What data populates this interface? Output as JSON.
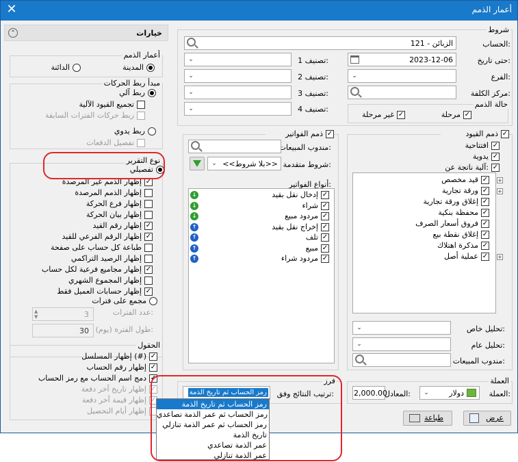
{
  "window": {
    "title": "أعمار الذمم",
    "close": "✕"
  },
  "options": {
    "header": "خيارات",
    "debt_ages": {
      "title": "أعمار الذمم",
      "debit": "المدينة",
      "credit": "الدائنة"
    },
    "link": {
      "title": "مبدأ ربط الحركات",
      "auto": "ربط آلي",
      "group_auto": "تجميع القيود الآلية",
      "link_prev": "ربط حركات الفترات السابقة",
      "manual": "ربط يدوي",
      "payment_detail": "تفصيل الدفعات"
    },
    "report_type": {
      "title": "نوع التقرير",
      "detailed": "تفصيلي",
      "items": [
        {
          "label": "إظهار الذمم غير المرصدة",
          "checked": true
        },
        {
          "label": "إظهار الذمم المرصدة",
          "checked": false
        },
        {
          "label": "إظهار فرع الحركة",
          "checked": false
        },
        {
          "label": "إظهار بيان الحركة",
          "checked": false
        },
        {
          "label": "إظهار رقم القيد",
          "checked": true
        },
        {
          "label": "إظهار الرقم الفرعي للقيد",
          "checked": true
        },
        {
          "label": "طباعة كل حساب على صفحة",
          "checked": false
        },
        {
          "label": "إظهار الرصيد التراكمي",
          "checked": false
        },
        {
          "label": "إظهار مجاميع فرعية لكل حساب",
          "checked": true
        },
        {
          "label": "إظهار المجموع الشهري",
          "checked": false
        },
        {
          "label": "إظهار حسابات العميل فقط",
          "checked": true
        }
      ],
      "periods": "مجمع على فترات",
      "periods_count_label": "عدد الفترات:",
      "periods_count": "3",
      "period_length_label": "طول الفترة (يوم):",
      "period_length": "30"
    },
    "fields": {
      "title": "الحقول",
      "items": [
        {
          "label": "إظهار المسلسل (#)",
          "checked": true,
          "disabled": false
        },
        {
          "label": "إظهار رقم الحساب",
          "checked": true,
          "disabled": false
        },
        {
          "label": "دمج اسم الحساب مع رمز الحساب",
          "checked": true,
          "disabled": false
        },
        {
          "label": "إظهار تاريخ آخر دفعة",
          "checked": true,
          "disabled": true
        },
        {
          "label": "إظهار قيمة آخر دفعة",
          "checked": true,
          "disabled": true
        },
        {
          "label": "إظهار أيام التحصيل",
          "checked": false,
          "disabled": true
        }
      ]
    }
  },
  "conditions": {
    "title": "شروط",
    "account_label": "الحساب:",
    "account_value": "121 - الزبائن",
    "until_label": "حتى تاريخ:",
    "until_value": "2023-12-06",
    "branch_label": "الفرع:",
    "cost_center_label": "مركز الكلفة:",
    "class1": "تصنيف 1:",
    "class2": "تصنيف 2:",
    "class3": "تصنيف 3:",
    "class4": "تصنيف 4:",
    "debt_state": {
      "title": "حالة الذمم",
      "staged": "مرحلة",
      "unstaged": "غير مرحلة"
    }
  },
  "invoices": {
    "title": "ذمم الفواتير",
    "sales_rep_label": "مندوب المبيعات:",
    "advanced_label": "شروط متقدمة:",
    "advanced_value": "<<بلا شروط>>",
    "types_label": "أنواع الفواتير:",
    "types": [
      {
        "label": "إدخال نقل بقيد",
        "dir": "down"
      },
      {
        "label": "شراء",
        "dir": "down"
      },
      {
        "label": "مردود مبيع",
        "dir": "down"
      },
      {
        "label": "إخراج نقل بقيد",
        "dir": "up"
      },
      {
        "label": "تلف",
        "dir": "up"
      },
      {
        "label": "مبيع",
        "dir": "up"
      },
      {
        "label": "مردود شراء",
        "dir": "up"
      }
    ]
  },
  "entries": {
    "title": "ذمم القيود",
    "opening": "افتتاحية",
    "manual": "يدوية",
    "auto_from": "آلية ناتجة عن:",
    "tree": [
      {
        "label": "قيد مخصص",
        "plus": true
      },
      {
        "label": "ورقة تجارية",
        "plus": true
      },
      {
        "label": "إغلاق ورقة تجارية",
        "plus": false
      },
      {
        "label": "محفظة بنكية",
        "plus": false
      },
      {
        "label": "فروق أسعار الصرف",
        "plus": false
      },
      {
        "label": "إغلاق نقطة بيع",
        "plus": false
      },
      {
        "label": "مذكرة اهتلاك",
        "plus": false
      },
      {
        "label": "عملية أصل",
        "plus": true
      }
    ],
    "special_analysis": "تحليل خاص:",
    "general_analysis": "تحليل عام:",
    "sales_rep": "مندوب المبيعات:"
  },
  "sort": {
    "title": "فرز",
    "label": "ترتيب النتائج وفق:",
    "value": "رمز الحساب ثم تاريخ الذمة",
    "options": [
      "رمز الحساب ثم تاريخ الذمة",
      "رمز الحساب ثم عمر الذمة تصاعدي",
      "رمز الحساب ثم عمر الذمة تنازلي",
      "تاريخ الذمة",
      "عمر الذمة تصاعدي",
      "عمر الذمة تنازلي"
    ]
  },
  "currency": {
    "title": "العملة",
    "label": "العملة:",
    "value": "دولار",
    "rate_label": "المعادل:",
    "rate_value": "2,000.00"
  },
  "buttons": {
    "show": "عرض",
    "print": "طباعة"
  },
  "colors": {
    "titlebar": "#1979ca",
    "selection": "#1979ca",
    "annotation": "#e0262b"
  }
}
